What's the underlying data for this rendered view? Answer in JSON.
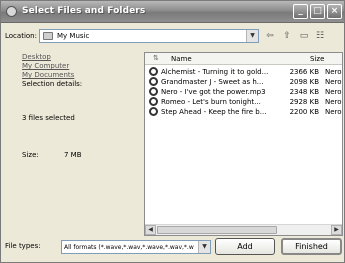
{
  "window": {
    "title": "Select Files and Folders"
  },
  "location": {
    "label": "Location:",
    "value": "My Music"
  },
  "tree": {
    "items": [
      {
        "label": "Desktop"
      },
      {
        "label": "My Computer"
      },
      {
        "label": "My Documents"
      }
    ]
  },
  "selection": {
    "details_label": "Selection details:",
    "count_text": "3 files selected",
    "size_label": "Size:",
    "size_value": "7 MB"
  },
  "list": {
    "columns": {
      "name": "Name",
      "size": "Size"
    },
    "rows": [
      {
        "name": "Alchemist - Turning it to gold...",
        "size": "2366 KB",
        "extra": "Nerol"
      },
      {
        "name": "Grandmaster J - Sweet as h...",
        "size": "2098 KB",
        "extra": "Nerol"
      },
      {
        "name": "Nero - I've got the power.mp3",
        "size": "2348 KB",
        "extra": "Nerol"
      },
      {
        "name": "Romeo - Let's burn tonight...",
        "size": "2928 KB",
        "extra": "Nerol"
      },
      {
        "name": "Step Ahead - Keep the fire b...",
        "size": "2200 KB",
        "extra": "Nerol"
      }
    ]
  },
  "footer": {
    "file_types_label": "File types:",
    "file_types_value": "All formats (*.wave,*.wav,*.wave,*.wav,*.w",
    "add_label": "Add",
    "finished_label": "Finished"
  }
}
